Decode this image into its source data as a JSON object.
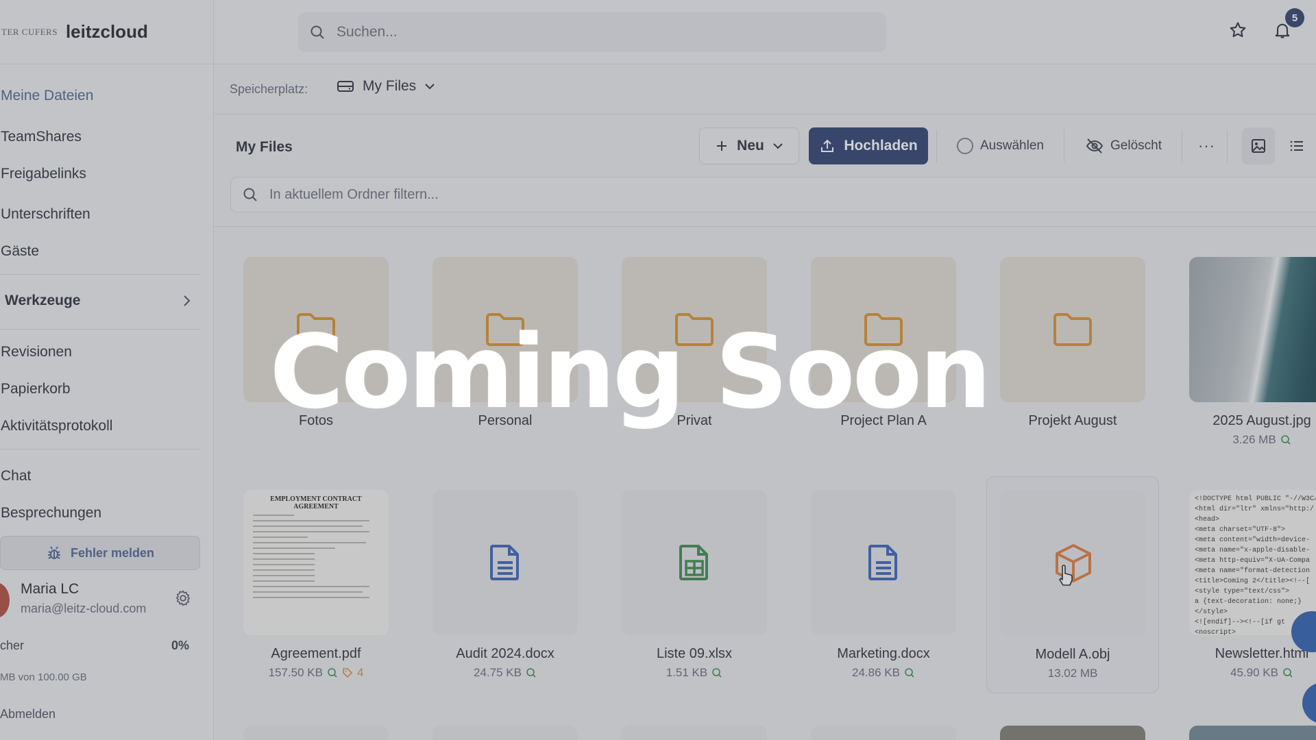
{
  "app": {
    "logo_mark": "TER CUFERS",
    "logo_text": "leitzcloud"
  },
  "sidebar": {
    "items": [
      {
        "label": "Meine Dateien"
      },
      {
        "label": "TeamShares"
      },
      {
        "label": "Freigabelinks"
      },
      {
        "label": "Unterschriften"
      },
      {
        "label": "Gäste"
      },
      {
        "label": "Revisionen"
      },
      {
        "label": "Papierkorb"
      },
      {
        "label": "Aktivitätsprotokoll"
      },
      {
        "label": "Chat"
      },
      {
        "label": "Besprechungen"
      }
    ],
    "tools_group": "Werkzeuge",
    "report_button": "Fehler melden",
    "user": {
      "name": "Maria LC",
      "email": "maria@leitz-cloud.com"
    },
    "storage": {
      "label": "cher",
      "percent": "0%",
      "used": "MB von 100.00 GB"
    },
    "logout": "Abmelden"
  },
  "topbar": {
    "search_placeholder": "Suchen...",
    "notification_count": "5"
  },
  "location": {
    "label": "Speicherplatz:",
    "value": "My Files"
  },
  "toolbar": {
    "folder_title": "My Files",
    "new_label": "Neu",
    "upload_label": "Hochladen",
    "select_label": "Auswählen",
    "deleted_label": "Gelöscht",
    "more_label": "···",
    "filter_placeholder": "In aktuellem Ordner filtern..."
  },
  "files": {
    "row1": [
      {
        "name": "Fotos",
        "type": "folder"
      },
      {
        "name": "Personal",
        "type": "folder"
      },
      {
        "name": "Privat",
        "type": "folder"
      },
      {
        "name": "Project Plan A",
        "type": "folder"
      },
      {
        "name": "Projekt August",
        "type": "folder"
      },
      {
        "name": "2025 August.jpg",
        "size": "3.26 MB",
        "type": "image"
      }
    ],
    "row2": [
      {
        "name": "Agreement.pdf",
        "size": "157.50 KB",
        "tags": "4",
        "type": "pdf"
      },
      {
        "name": "Audit 2024.docx",
        "size": "24.75 KB",
        "type": "docx"
      },
      {
        "name": "Liste 09.xlsx",
        "size": "1.51 KB",
        "type": "xlsx"
      },
      {
        "name": "Marketing.docx",
        "size": "24.86 KB",
        "type": "docx"
      },
      {
        "name": "Modell A.obj",
        "size": "13.02 MB",
        "type": "obj"
      },
      {
        "name": "Newsletter.html",
        "size": "45.90 KB",
        "type": "html"
      }
    ],
    "contract_title": "EMPLOYMENT CONTRACT AGREEMENT",
    "newsletter_code": [
      "<!DOCTYPE html PUBLIC \"-//W3C/",
      "<html dir=\"ltr\" xmlns=\"http:/",
      "  <head>",
      "    <meta charset=\"UTF-8\">",
      "    <meta content=\"width=device-",
      "    <meta name=\"x-apple-disable-",
      "    <meta http-equiv=\"X-UA-Compa",
      "    <meta name=\"format-detection",
      "    <title>Coming 2</title><!--[",
      "      <style type=\"text/css\">",
      "      a {text-decoration: none;}",
      "      </style>",
      "      <![endif]--><!--[if gt",
      "<noscript>"
    ]
  },
  "overlay": {
    "text": "Coming Soon"
  },
  "colors": {
    "accent": "#2b3e6e",
    "folder": "#d9902c",
    "doc_blue": "#3a62b8",
    "sheet_green": "#3a8a4a",
    "obj_orange": "#e07a3a"
  }
}
